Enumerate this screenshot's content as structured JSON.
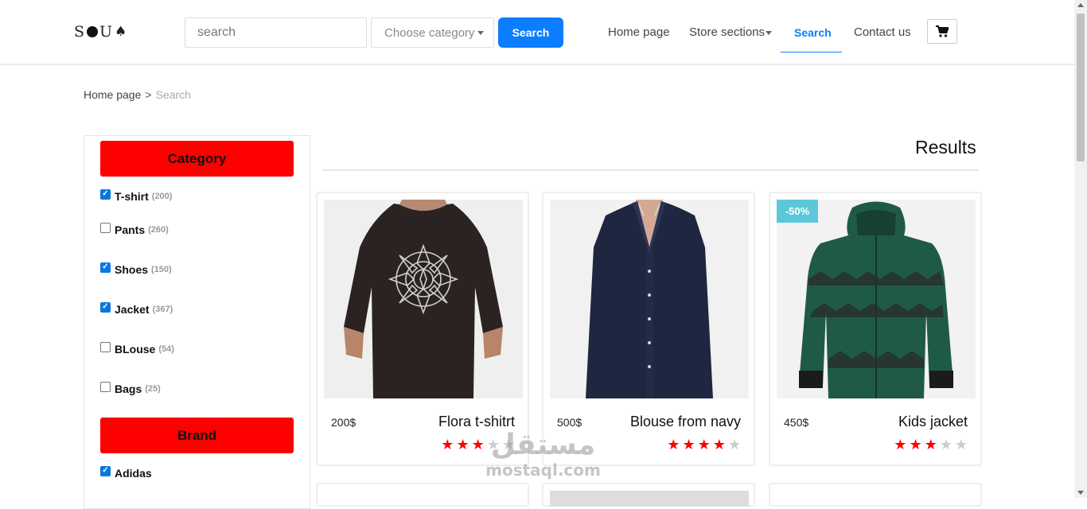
{
  "header": {
    "logo": "S●U♠",
    "search_placeholder": "search",
    "category_label": "Choose category",
    "search_button": "Search",
    "nav": {
      "home": "Home page",
      "sections": "Store sections",
      "search": "Search",
      "contact": "Contact us"
    }
  },
  "breadcrumb": {
    "home": "Home page",
    "separator": ">",
    "current": "Search"
  },
  "sidebar": {
    "category_title": "Category",
    "categories": [
      {
        "label": "T-shirt",
        "count": "(200)",
        "checked": true
      },
      {
        "label": "Pants",
        "count": "(260)",
        "checked": false
      },
      {
        "label": "Shoes",
        "count": "(150)",
        "checked": true
      },
      {
        "label": "Jacket",
        "count": "(367)",
        "checked": true
      },
      {
        "label": "BLouse",
        "count": "(54)",
        "checked": false
      },
      {
        "label": "Bags",
        "count": "(25)",
        "checked": false
      }
    ],
    "brand_title": "Brand",
    "brands": [
      {
        "label": "Adidas",
        "checked": true
      }
    ]
  },
  "results": {
    "title": "Results",
    "products": [
      {
        "name": "Flora t-shitrt",
        "price": "200$",
        "rating": 3,
        "max_rating": 5,
        "badge": ""
      },
      {
        "name": "Blouse from navy",
        "price": "500$",
        "rating": 4,
        "max_rating": 5,
        "badge": ""
      },
      {
        "name": "Kids jacket",
        "price": "450$",
        "rating": 3,
        "max_rating": 5,
        "badge": "-50%"
      }
    ]
  },
  "watermark": {
    "arabic": "مستقل",
    "latin": "mostaql.com"
  },
  "colors": {
    "accent_blue": "#0b7dff",
    "sidebar_header": "#ff0000",
    "star_on": "#ff0000",
    "badge": "#5bc8d9"
  }
}
